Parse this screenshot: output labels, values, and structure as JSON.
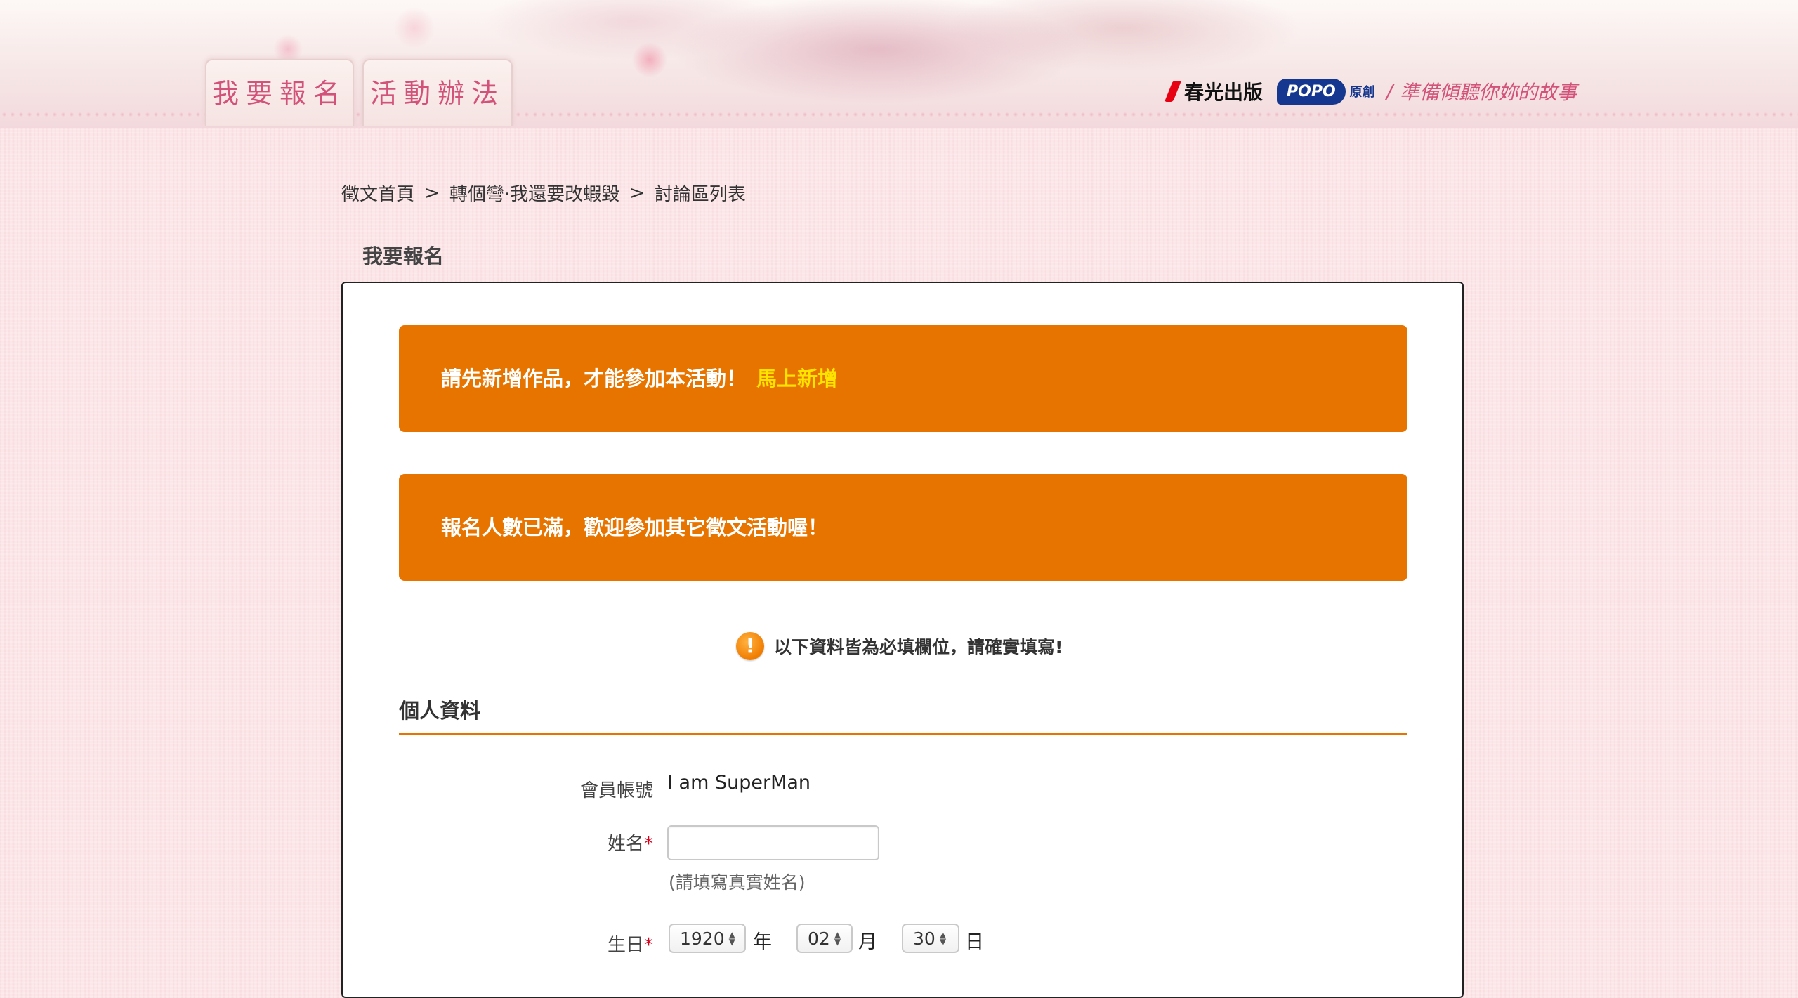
{
  "header": {
    "tabs": [
      {
        "label": "我要報名"
      },
      {
        "label": "活動辦法"
      }
    ],
    "brand": {
      "spring_label": "春光出版",
      "popo_label": "POPO",
      "popo_sub": "原創",
      "slash": "/",
      "slogan": "準備傾聽你妳的故事"
    }
  },
  "breadcrumb": {
    "items": [
      "徵文首頁",
      "轉個彎·我還要改蝦毀",
      "討論區列表"
    ],
    "separator": ">"
  },
  "page": {
    "heading": "我要報名"
  },
  "notices": {
    "first_text": "請先新增作品，才能參加本活動！",
    "first_link": "馬上新增",
    "second_text": "報名人數已滿，歡迎參加其它徵文活動喔！"
  },
  "required_note": {
    "icon": "!",
    "text": "以下資料皆為必填欄位，請確實填寫!"
  },
  "personal": {
    "title": "個人資料",
    "account_label": "會員帳號",
    "account_value": "I am SuperMan",
    "name_label": "姓名",
    "name_value": "",
    "name_hint": "(請填寫真實姓名)",
    "birthday_label": "生日",
    "required_mark": "*",
    "birth_year": "1920",
    "year_unit": "年",
    "birth_month": "02",
    "month_unit": "月",
    "birth_day": "30",
    "day_unit": "日"
  }
}
